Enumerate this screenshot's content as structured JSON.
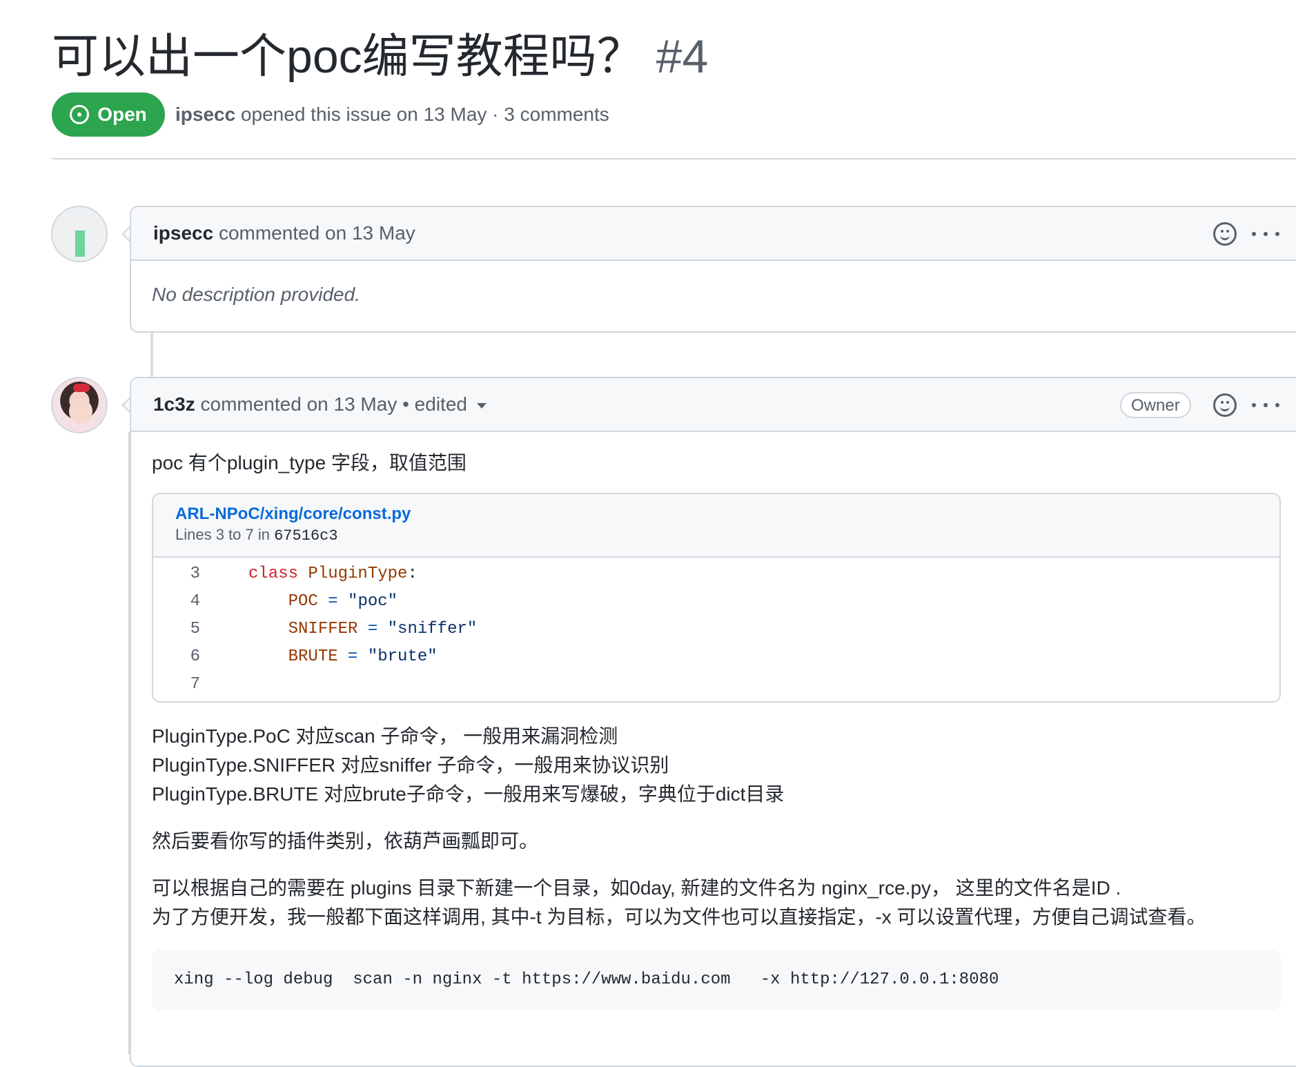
{
  "issue": {
    "title": "可以出一个poc编写教程吗？",
    "number": "#4",
    "state": "Open",
    "author": "ipsecc",
    "meta_text": "opened this issue on 13 May · 3 comments"
  },
  "comments": [
    {
      "author": "ipsecc",
      "action": "commented on 13 May",
      "body": "No description provided."
    },
    {
      "author": "1c3z",
      "action": "commented on 13 May",
      "edited": "• edited",
      "badge": "Owner",
      "intro": "poc 有个plugin_type 字段，取值范围",
      "embed": {
        "path": "ARL-NPoC/xing/core/const.py",
        "lines_prefix": "Lines 3 to 7 in ",
        "sha": "67516c3",
        "code": [
          {
            "no": "3",
            "kw": "class ",
            "cls": "PluginType",
            "rest": ":",
            "var": "",
            "op": "",
            "str": ""
          },
          {
            "no": "4",
            "indent": "    ",
            "var": "POC",
            "op": " = ",
            "str": "\"poc\""
          },
          {
            "no": "5",
            "indent": "    ",
            "var": "SNIFFER",
            "op": " = ",
            "str": "\"sniffer\""
          },
          {
            "no": "6",
            "indent": "    ",
            "var": "BRUTE",
            "op": " = ",
            "str": "\"brute\""
          },
          {
            "no": "7",
            "indent": "",
            "var": "",
            "op": "",
            "str": ""
          }
        ]
      },
      "paragraph1": [
        "PluginType.PoC 对应scan 子命令， 一般用来漏洞检测",
        "PluginType.SNIFFER 对应sniffer 子命令，一般用来协议识别",
        "PluginType.BRUTE 对应brute子命令，一般用来写爆破，字典位于dict目录"
      ],
      "paragraph2": "然后要看你写的插件类别，依葫芦画瓢即可。",
      "paragraph3": [
        "可以根据自己的需要在 plugins 目录下新建一个目录，如0day, 新建的文件名为 nginx_rce.py，  这里的文件名是ID .",
        "为了方便开发，我一般都下面这样调用, 其中-t 为目标，可以为文件也可以直接指定，-x 可以设置代理，方便自己调试查看。"
      ],
      "command": "xing --log debug  scan -n nginx -t https://www.baidu.com   -x http://127.0.0.1:8080"
    }
  ],
  "colors": {
    "open_green": "#2da44e",
    "link_blue": "#0969da",
    "border": "#d0d7de",
    "muted": "#57606a"
  },
  "icons": [
    "issue-open-icon",
    "smiley-icon",
    "kebab-horizontal-icon",
    "triangle-down-icon"
  ]
}
